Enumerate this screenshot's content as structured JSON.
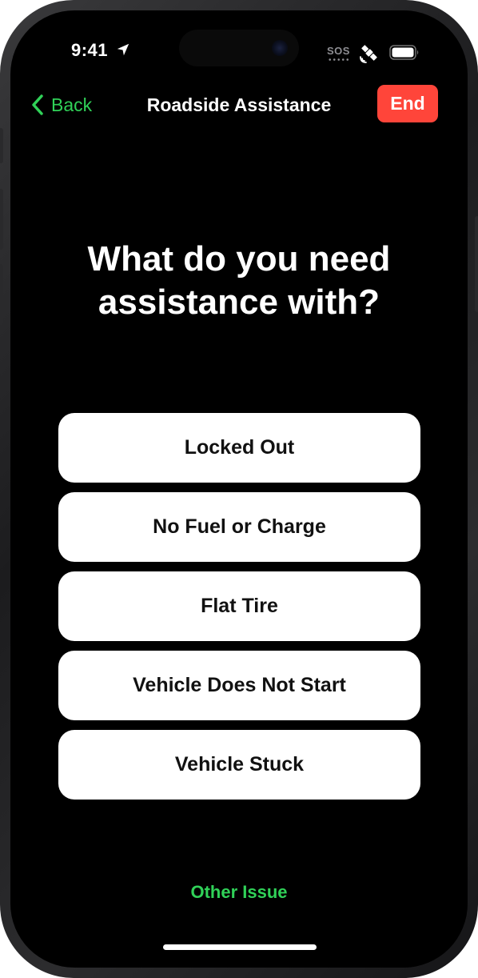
{
  "status_bar": {
    "time": "9:41",
    "sos": "SOS",
    "icons": [
      "location-arrow-icon",
      "satellite-icon",
      "battery-icon"
    ]
  },
  "nav": {
    "back_label": "Back",
    "title": "Roadside Assistance",
    "end_label": "End"
  },
  "main": {
    "headline": "What do you need assistance with?",
    "options": [
      "Locked Out",
      "No Fuel or Charge",
      "Flat Tire",
      "Vehicle Does Not Start",
      "Vehicle Stuck"
    ],
    "other_issue_label": "Other Issue"
  },
  "colors": {
    "accent_green": "#30d158",
    "end_red": "#ff453a",
    "background": "#000000",
    "option_background": "#ffffff"
  }
}
